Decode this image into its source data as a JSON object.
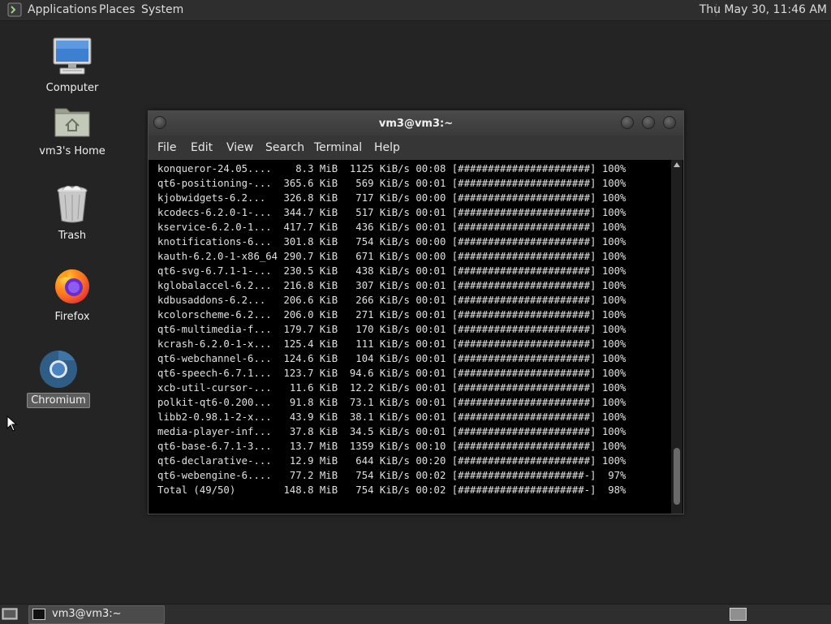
{
  "top_panel": {
    "menus": [
      "Applications",
      "Places",
      "System"
    ],
    "clock": "Thu May 30, 11:46 AM"
  },
  "desktop": {
    "icons": [
      {
        "label": "Computer",
        "icon": "computer-icon"
      },
      {
        "label": "vm3's Home",
        "icon": "home-folder-icon"
      },
      {
        "label": "Trash",
        "icon": "trash-icon"
      },
      {
        "label": "Firefox",
        "icon": "firefox-icon"
      },
      {
        "label": "Chromium",
        "icon": "chromium-icon",
        "selected": true
      }
    ]
  },
  "terminal": {
    "title": "vm3@vm3:~",
    "menu": [
      "File",
      "Edit",
      "View",
      "Search",
      "Terminal",
      "Help"
    ],
    "lines": [
      "konqueror-24.05....    8.3 MiB  1125 KiB/s 00:08 [######################] 100%",
      "qt6-positioning-...  365.6 KiB   569 KiB/s 00:01 [######################] 100%",
      "kjobwidgets-6.2...   326.8 KiB   717 KiB/s 00:00 [######################] 100%",
      "kcodecs-6.2.0-1-...  344.7 KiB   517 KiB/s 00:01 [######################] 100%",
      "kservice-6.2.0-1...  417.7 KiB   436 KiB/s 00:01 [######################] 100%",
      "knotifications-6...  301.8 KiB   754 KiB/s 00:00 [######################] 100%",
      "kauth-6.2.0-1-x86_64 290.7 KiB   671 KiB/s 00:00 [######################] 100%",
      "qt6-svg-6.7.1-1-...  230.5 KiB   438 KiB/s 00:01 [######################] 100%",
      "kglobalaccel-6.2...  216.8 KiB   307 KiB/s 00:01 [######################] 100%",
      "kdbusaddons-6.2...   206.6 KiB   266 KiB/s 00:01 [######################] 100%",
      "kcolorscheme-6.2...  206.0 KiB   271 KiB/s 00:01 [######################] 100%",
      "qt6-multimedia-f...  179.7 KiB   170 KiB/s 00:01 [######################] 100%",
      "kcrash-6.2.0-1-x...  125.4 KiB   111 KiB/s 00:01 [######################] 100%",
      "qt6-webchannel-6...  124.6 KiB   104 KiB/s 00:01 [######################] 100%",
      "qt6-speech-6.7.1...  123.7 KiB  94.6 KiB/s 00:01 [######################] 100%",
      "xcb-util-cursor-...   11.6 KiB  12.2 KiB/s 00:01 [######################] 100%",
      "polkit-qt6-0.200...   91.8 KiB  73.1 KiB/s 00:01 [######################] 100%",
      "libb2-0.98.1-2-x...   43.9 KiB  38.1 KiB/s 00:01 [######################] 100%",
      "media-player-inf...   37.8 KiB  34.5 KiB/s 00:01 [######################] 100%",
      "qt6-base-6.7.1-3...   13.7 MiB  1359 KiB/s 00:10 [######################] 100%",
      "qt6-declarative-...   12.9 MiB   644 KiB/s 00:20 [######################] 100%",
      "qt6-webengine-6....   77.2 MiB   754 KiB/s 00:02 [#####################-]  97%",
      "Total (49/50)        148.8 MiB   754 KiB/s 00:02 [#####################-]  98%"
    ]
  },
  "taskbar": {
    "tasks": [
      {
        "label": "vm3@vm3:~",
        "icon": "terminal-icon"
      }
    ]
  }
}
